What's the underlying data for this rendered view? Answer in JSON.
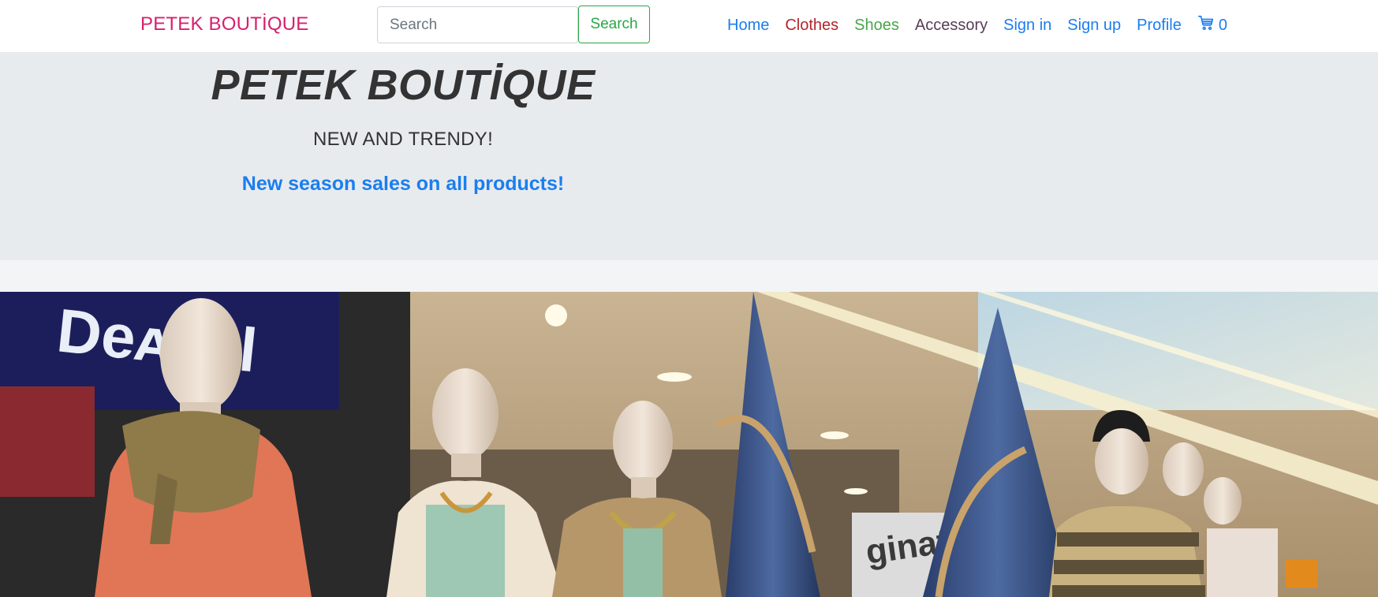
{
  "navbar": {
    "brand": "PETEK BOUTİQUE",
    "search": {
      "placeholder": "Search",
      "value": "",
      "button_label": "Search"
    },
    "links": {
      "home": "Home",
      "clothes": "Clothes",
      "shoes": "Shoes",
      "accessory": "Accessory",
      "sign_in": "Sign in",
      "sign_up": "Sign up",
      "profile": "Profile"
    },
    "cart": {
      "icon": "cart-icon",
      "count": "0"
    }
  },
  "jumbotron": {
    "title": "PETEK BOUTİQUE",
    "subtitle": "NEW AND TRENDY!",
    "promo": "New season sales on all products!"
  },
  "hero": {
    "description": "Photo of mannequins in a shopping mall",
    "sign_text": "Desigual",
    "shop_sign_text": "ginatri"
  },
  "colors": {
    "brand": "#d6206e",
    "link_blue": "#1a7ef0",
    "clothes": "#b3262b",
    "shoes": "#48a54a",
    "accessory": "#5a3d55",
    "success": "#28a745",
    "jumbotron_bg": "#e8ebee",
    "title_text": "#333333"
  }
}
